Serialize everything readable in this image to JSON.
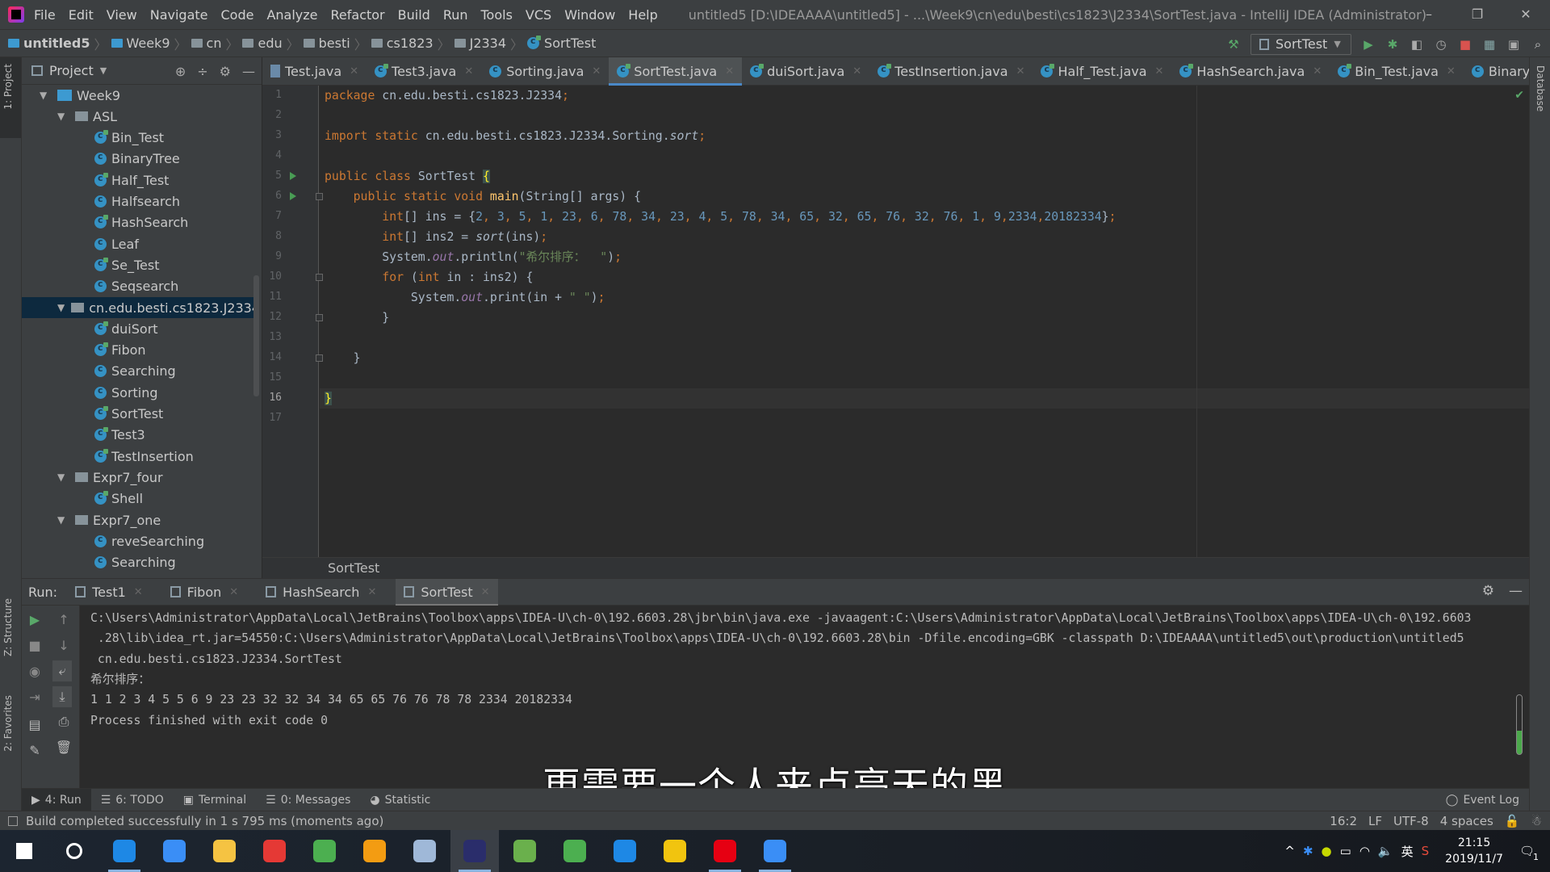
{
  "titlebar": {
    "menu": [
      "File",
      "Edit",
      "View",
      "Navigate",
      "Code",
      "Analyze",
      "Refactor",
      "Build",
      "Run",
      "Tools",
      "VCS",
      "Window",
      "Help"
    ],
    "title": "untitled5 [D:\\IDEAAAA\\untitled5] - ...\\Week9\\cn\\edu\\besti\\cs1823\\J2334\\SortTest.java - IntelliJ IDEA (Administrator)",
    "minimize": "–",
    "restore": "❐",
    "close": "✕"
  },
  "navbar": {
    "breadcrumbs": [
      "untitled5",
      "Week9",
      "cn",
      "edu",
      "besti",
      "cs1823",
      "J2334",
      "SortTest"
    ],
    "run_config": "SortTest"
  },
  "left_stripe": {
    "project": "1: Project",
    "structure": "Z: Structure",
    "favorites": "2: Favorites"
  },
  "right_stripe": {
    "database": "Database"
  },
  "project_panel": {
    "title": "Project",
    "tree": [
      {
        "label": "Week9",
        "depth": 0,
        "kind": "module",
        "expanded": true
      },
      {
        "label": "ASL",
        "depth": 1,
        "kind": "package",
        "expanded": true
      },
      {
        "label": "Bin_Test",
        "depth": 2,
        "kind": "class-run"
      },
      {
        "label": "BinaryTree",
        "depth": 2,
        "kind": "class"
      },
      {
        "label": "Half_Test",
        "depth": 2,
        "kind": "class-run"
      },
      {
        "label": "Halfsearch",
        "depth": 2,
        "kind": "class"
      },
      {
        "label": "HashSearch",
        "depth": 2,
        "kind": "class-run"
      },
      {
        "label": "Leaf",
        "depth": 2,
        "kind": "class"
      },
      {
        "label": "Se_Test",
        "depth": 2,
        "kind": "class-run"
      },
      {
        "label": "Seqsearch",
        "depth": 2,
        "kind": "class"
      },
      {
        "label": "cn.edu.besti.cs1823.J2334",
        "depth": 1,
        "kind": "package",
        "expanded": true,
        "selected": true
      },
      {
        "label": "duiSort",
        "depth": 2,
        "kind": "class-run"
      },
      {
        "label": "Fibon",
        "depth": 2,
        "kind": "class-run"
      },
      {
        "label": "Searching",
        "depth": 2,
        "kind": "class"
      },
      {
        "label": "Sorting",
        "depth": 2,
        "kind": "class"
      },
      {
        "label": "SortTest",
        "depth": 2,
        "kind": "class-run"
      },
      {
        "label": "Test3",
        "depth": 2,
        "kind": "class-run"
      },
      {
        "label": "TestInsertion",
        "depth": 2,
        "kind": "class-run"
      },
      {
        "label": "Expr7_four",
        "depth": 1,
        "kind": "package",
        "expanded": true
      },
      {
        "label": "Shell",
        "depth": 2,
        "kind": "class-run"
      },
      {
        "label": "Expr7_one",
        "depth": 1,
        "kind": "package",
        "expanded": true
      },
      {
        "label": "reveSearching",
        "depth": 2,
        "kind": "class"
      },
      {
        "label": "Searching",
        "depth": 2,
        "kind": "class"
      }
    ]
  },
  "editor_tabs": [
    {
      "label": "Test.java",
      "icon": "java-file"
    },
    {
      "label": "Test3.java",
      "icon": "class-run"
    },
    {
      "label": "Sorting.java",
      "icon": "class"
    },
    {
      "label": "SortTest.java",
      "icon": "class-run",
      "active": true
    },
    {
      "label": "duiSort.java",
      "icon": "class-run"
    },
    {
      "label": "TestInsertion.java",
      "icon": "class-run"
    },
    {
      "label": "Half_Test.java",
      "icon": "class-run"
    },
    {
      "label": "HashSearch.java",
      "icon": "class-run"
    },
    {
      "label": "Bin_Test.java",
      "icon": "class-run"
    },
    {
      "label": "BinaryTree.java",
      "icon": "class"
    }
  ],
  "editor": {
    "current_line": 16,
    "breadcrumb": "SortTest",
    "lines": [
      [
        [
          "k",
          "package "
        ],
        [
          "",
          "cn.edu.besti.cs1823.J2334"
        ],
        [
          "k",
          ";"
        ]
      ],
      [],
      [
        [
          "k",
          "import static "
        ],
        [
          "",
          "cn.edu.besti.cs1823.J2334.Sorting."
        ],
        [
          "i",
          "sort"
        ],
        [
          "k",
          ";"
        ]
      ],
      [],
      [
        [
          "k",
          "public class "
        ],
        [
          "",
          "SortTest "
        ],
        [
          "b",
          "{"
        ]
      ],
      [
        [
          "",
          "    "
        ],
        [
          "k",
          "public static void "
        ],
        [
          "m",
          "main"
        ],
        [
          "",
          "(String[] args) {"
        ]
      ],
      [
        [
          "",
          "        "
        ],
        [
          "k",
          "int"
        ],
        [
          "",
          "[] ins = {"
        ],
        [
          "n",
          "2"
        ],
        [
          "k",
          ", "
        ],
        [
          "n",
          "3"
        ],
        [
          "k",
          ", "
        ],
        [
          "n",
          "5"
        ],
        [
          "k",
          ", "
        ],
        [
          "n",
          "1"
        ],
        [
          "k",
          ", "
        ],
        [
          "n",
          "23"
        ],
        [
          "k",
          ", "
        ],
        [
          "n",
          "6"
        ],
        [
          "k",
          ", "
        ],
        [
          "n",
          "78"
        ],
        [
          "k",
          ", "
        ],
        [
          "n",
          "34"
        ],
        [
          "k",
          ", "
        ],
        [
          "n",
          "23"
        ],
        [
          "k",
          ", "
        ],
        [
          "n",
          "4"
        ],
        [
          "k",
          ", "
        ],
        [
          "n",
          "5"
        ],
        [
          "k",
          ", "
        ],
        [
          "n",
          "78"
        ],
        [
          "k",
          ", "
        ],
        [
          "n",
          "34"
        ],
        [
          "k",
          ", "
        ],
        [
          "n",
          "65"
        ],
        [
          "k",
          ", "
        ],
        [
          "n",
          "32"
        ],
        [
          "k",
          ", "
        ],
        [
          "n",
          "65"
        ],
        [
          "k",
          ", "
        ],
        [
          "n",
          "76"
        ],
        [
          "k",
          ", "
        ],
        [
          "n",
          "32"
        ],
        [
          "k",
          ", "
        ],
        [
          "n",
          "76"
        ],
        [
          "k",
          ", "
        ],
        [
          "n",
          "1"
        ],
        [
          "k",
          ", "
        ],
        [
          "n",
          "9"
        ],
        [
          "k",
          ","
        ],
        [
          "n",
          "2334"
        ],
        [
          "k",
          ","
        ],
        [
          "n",
          "20182334"
        ],
        [
          "",
          "}"
        ],
        [
          "k",
          ";"
        ]
      ],
      [
        [
          "",
          "        "
        ],
        [
          "k",
          "int"
        ],
        [
          "",
          "[] ins2 = "
        ],
        [
          "i",
          "sort"
        ],
        [
          "",
          "(ins)"
        ],
        [
          "k",
          ";"
        ]
      ],
      [
        [
          "",
          "        System."
        ],
        [
          "f",
          "out"
        ],
        [
          "",
          ".println("
        ],
        [
          "s",
          "\"希尔排序：  \""
        ],
        [
          "",
          ")"
        ],
        [
          "k",
          ";"
        ]
      ],
      [
        [
          "",
          "        "
        ],
        [
          "k",
          "for "
        ],
        [
          "",
          "("
        ],
        [
          "k",
          "int "
        ],
        [
          "",
          "in : ins2) {"
        ]
      ],
      [
        [
          "",
          "            System."
        ],
        [
          "f",
          "out"
        ],
        [
          "",
          ".print(in + "
        ],
        [
          "s",
          "\" \""
        ],
        [
          "",
          ")"
        ],
        [
          "k",
          ";"
        ]
      ],
      [
        [
          "",
          "        }"
        ]
      ],
      [],
      [
        [
          "",
          "    }"
        ]
      ],
      [],
      [
        [
          "b",
          "}"
        ]
      ],
      []
    ],
    "run_markers": [
      5,
      6
    ],
    "fold_markers": [
      6,
      10,
      12,
      14
    ]
  },
  "run_panel": {
    "label": "Run:",
    "tabs": [
      {
        "label": "Test1"
      },
      {
        "label": "Fibon"
      },
      {
        "label": "HashSearch"
      },
      {
        "label": "SortTest",
        "active": true
      }
    ],
    "console": [
      "C:\\Users\\Administrator\\AppData\\Local\\JetBrains\\Toolbox\\apps\\IDEA-U\\ch-0\\192.6603.28\\jbr\\bin\\java.exe -javaagent:C:\\Users\\Administrator\\AppData\\Local\\JetBrains\\Toolbox\\apps\\IDEA-U\\ch-0\\192.6603",
      " .28\\lib\\idea_rt.jar=54550:C:\\Users\\Administrator\\AppData\\Local\\JetBrains\\Toolbox\\apps\\IDEA-U\\ch-0\\192.6603.28\\bin -Dfile.encoding=GBK -classpath D:\\IDEAAAA\\untitled5\\out\\production\\untitled5",
      " cn.edu.besti.cs1823.J2334.SortTest",
      "希尔排序：",
      "1 1 2 3 4 5 5 6 9 23 23 32 32 34 34 65 65 76 76 78 78 2334 20182334",
      "Process finished with exit code 0"
    ]
  },
  "subtitle": "更需要一个人来点亮天的黑",
  "bottom_tools": [
    {
      "label": "4: Run",
      "icon": "run-icon",
      "active": true
    },
    {
      "label": "6: TODO",
      "icon": "todo-icon"
    },
    {
      "label": "Terminal",
      "icon": "terminal-icon"
    },
    {
      "label": "0: Messages",
      "icon": "messages-icon"
    },
    {
      "label": "Statistic",
      "icon": "statistic-icon"
    }
  ],
  "event_log": "Event Log",
  "statusbar": {
    "message": "Build completed successfully in 1 s 795 ms (moments ago)",
    "position": "16:2",
    "line_sep": "LF",
    "encoding": "UTF-8",
    "indent": "4 spaces"
  },
  "taskbar": {
    "apps": [
      {
        "name": "start",
        "color": "#ffffff"
      },
      {
        "name": "search",
        "color": "#ffffff"
      },
      {
        "name": "edge",
        "color": "#1e88e5",
        "open": true
      },
      {
        "name": "feishu",
        "color": "#3a8ef6"
      },
      {
        "name": "file-explorer",
        "color": "#f5c342"
      },
      {
        "name": "youdao",
        "color": "#e53935"
      },
      {
        "name": "chrome",
        "color": "#4caf50"
      },
      {
        "name": "app-orange",
        "color": "#f39c12"
      },
      {
        "name": "app-pinwheel",
        "color": "#9fb8d8"
      },
      {
        "name": "intellij",
        "color": "#2a2d6b",
        "active": true
      },
      {
        "name": "android-studio",
        "color": "#6ab04c"
      },
      {
        "name": "wechat",
        "color": "#4caf50"
      },
      {
        "name": "app-star",
        "color": "#1e88e5"
      },
      {
        "name": "app-yellow",
        "color": "#f1c40f"
      },
      {
        "name": "netease-music",
        "color": "#e60012",
        "open": true
      },
      {
        "name": "app-phone",
        "color": "#3a8ef6",
        "open": true
      }
    ],
    "ime": "英",
    "time": "21:15",
    "date": "2019/11/7",
    "notifications": "1"
  }
}
